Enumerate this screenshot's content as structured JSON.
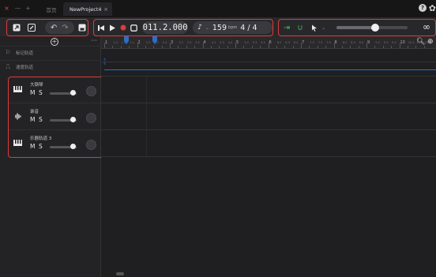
{
  "window": {
    "tabs": [
      {
        "label": "首页"
      },
      {
        "label": "NewProject4"
      }
    ],
    "tab_close": "×"
  },
  "toolbar": {
    "time_display": "011.2.000",
    "bpm_value": "159",
    "bpm_unit": "bpm",
    "time_signature": "4 / 4",
    "tempo_icon": "metronome-icon"
  },
  "panel": {
    "marker_track_label": "标记轨道",
    "tempo_track_label": "速度轨道"
  },
  "tracks": [
    {
      "name": "大钢琴",
      "mute": "M",
      "solo": "S",
      "icon": "piano-icon",
      "volume": 0.85
    },
    {
      "name": "录音",
      "mute": "M",
      "solo": "S",
      "icon": "waveform-icon",
      "volume": 0.85
    },
    {
      "name": "乐器轨道 3",
      "mute": "M",
      "solo": "S",
      "icon": "piano-icon",
      "volume": 0.85
    }
  ],
  "timeline": {
    "bars": [
      "1",
      "2",
      "3",
      "4",
      "5",
      "6",
      "7",
      "8",
      "9",
      "10"
    ],
    "time_signature_label": "4\n4"
  },
  "colors": {
    "accent_red": "#e03a3a",
    "accent_green": "#3fbf52",
    "tempo_blue": "#2a6fc8"
  }
}
